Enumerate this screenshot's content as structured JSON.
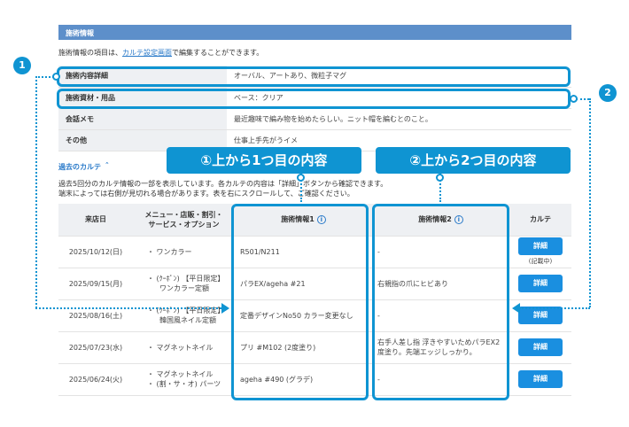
{
  "section": {
    "title": "施術情報"
  },
  "intro": {
    "prefix": "施術情報の項目は、",
    "link": "カルテ設定画面",
    "suffix": "で編集することができます。"
  },
  "info_rows": [
    {
      "label": "施術内容詳細",
      "value": "オーバル、アートあり、微粒子マグ"
    },
    {
      "label": "施術資材・用品",
      "value": "ベース：クリア"
    },
    {
      "label": "会話メモ",
      "value": "最近趣味で編み物を始めたらしい。ニット帽を編むとのこと。"
    },
    {
      "label": "その他",
      "value": "仕事上手先がうイメ"
    }
  ],
  "past": {
    "toggle": "過去のカルテ ＾",
    "desc_line1": "過去5回分のカルテ情報の一部を表示しています。各カルテの内容は「詳細」ボタンから確認できます。",
    "desc_line2": "端末によっては右側が見切れる場合があります。表を右にスクロールして、ご確認ください。"
  },
  "table": {
    "headers": {
      "date": "来店日",
      "menu_line1": "メニュー・店販・割引・",
      "menu_line2": "サービス・オプション",
      "info1": "施術情報1",
      "info2": "施術情報2",
      "karte": "カルテ"
    },
    "rows": [
      {
        "date": "2025/10/12(日)",
        "menu1": "・ ワンカラー",
        "menu2": "",
        "info1": "R501/N211",
        "info2": "-",
        "btn": "詳細",
        "note": "(記載中)"
      },
      {
        "date": "2025/09/15(月)",
        "menu1": "・ (ｸｰﾎﾟﾝ) 【平日限定】",
        "menu2": "ワンカラー定額",
        "info1": "パラEX/ageha #21",
        "info2": "右親指の爪にヒビあり",
        "btn": "詳細",
        "note": ""
      },
      {
        "date": "2025/08/16(土)",
        "menu1": "・ (ｸｰﾎﾟﾝ) 【平日限定】",
        "menu2": "韓国風ネイル定額",
        "info1": "定番デザインNo50 カラー変更なし",
        "info2": "-",
        "btn": "詳細",
        "note": ""
      },
      {
        "date": "2025/07/23(水)",
        "menu1": "・ マグネットネイル",
        "menu2": "",
        "info1": "プリ #M102 (2度塗り)",
        "info2": "右手人差し指 浮きやすいためパラEX2度塗り。先端エッジしっかり。",
        "btn": "詳細",
        "note": ""
      },
      {
        "date": "2025/06/24(火)",
        "menu1": "・ マグネットネイル",
        "menu2": "・ (割・サ・オ) パーツ",
        "info1": "ageha #490 (グラデ)",
        "info2": "-",
        "btn": "詳細",
        "note": ""
      }
    ]
  },
  "annotations": {
    "badge1": "1",
    "badge2": "2",
    "callout1": "①上から1つ目の内容",
    "callout2": "②上から2つ目の内容",
    "info_icon": "i"
  },
  "colors": {
    "accent": "#0f94d2",
    "header_bar": "#5d8fca",
    "button": "#1a8fe0",
    "label_bg": "#eef0f3"
  }
}
